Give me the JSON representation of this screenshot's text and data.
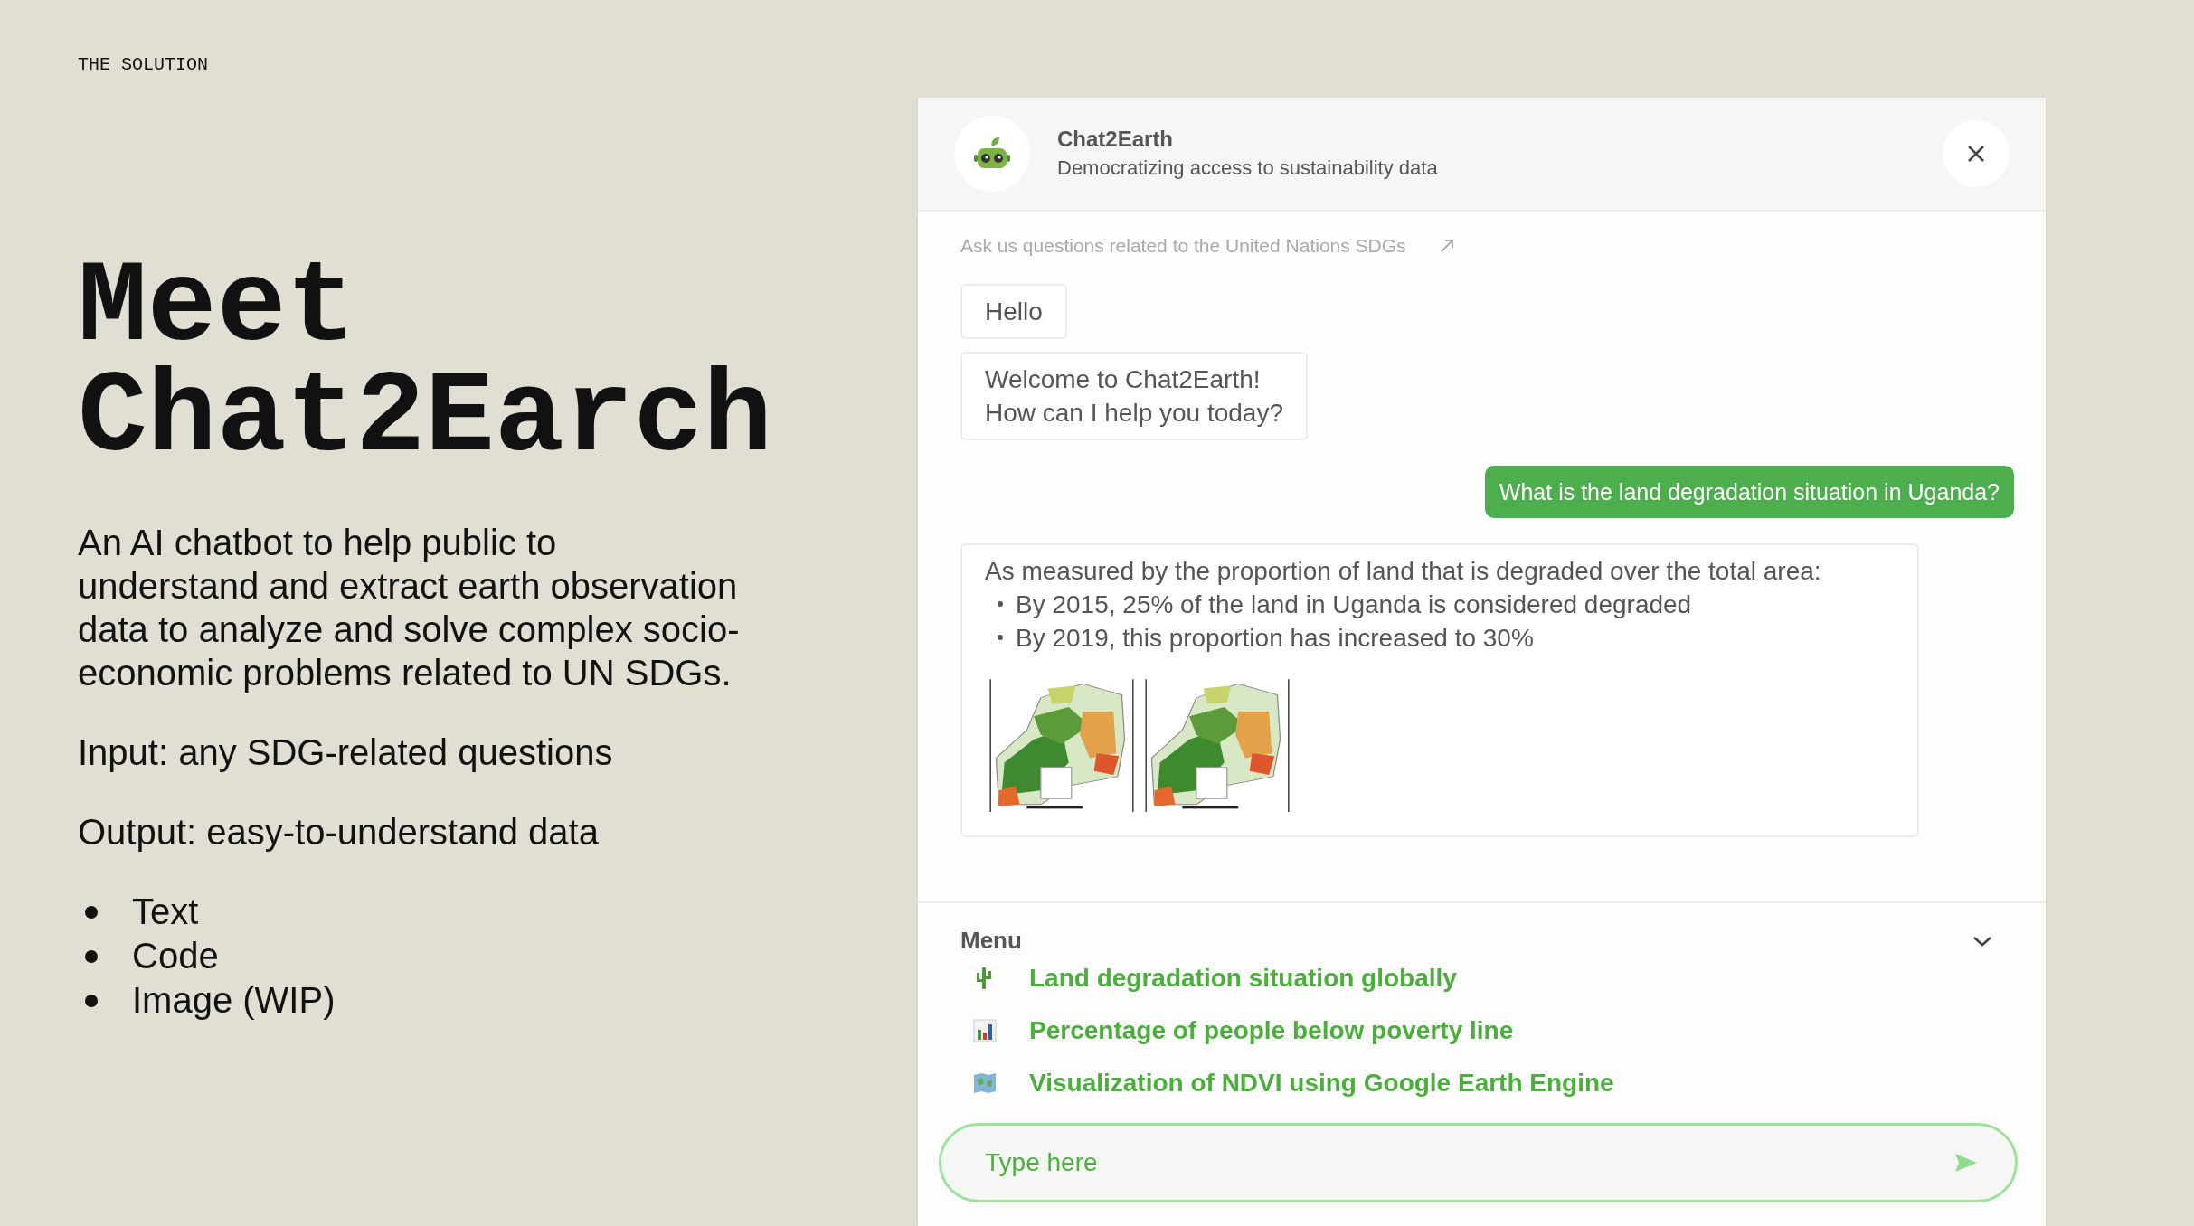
{
  "slide": {
    "eyebrow": "THE SOLUTION",
    "title_lines": [
      "Meet",
      "Chat2Earch"
    ],
    "description": "An AI chatbot to help public to understand and extract earth observation data to analyze and solve complex socio-economic problems related to UN SDGs.",
    "paragraphs": [
      "Input: any SDG-related questions",
      "Output: easy-to-understand data"
    ],
    "bullets": [
      "Text",
      "Code",
      "Image (WIP)"
    ]
  },
  "chat": {
    "title": "Chat2Earth",
    "subtitle": "Democratizing access to sustainability data",
    "hint": "Ask us questions related to the United Nations SDGs",
    "messages": [
      {
        "kind": "bot",
        "lines": [
          "Hello"
        ]
      },
      {
        "kind": "bot",
        "lines": [
          "Welcome to Chat2Earth!",
          "How can I help you today?"
        ]
      },
      {
        "kind": "user",
        "lines": [
          "What is the land degradation situation in Uganda?"
        ]
      },
      {
        "kind": "bot",
        "lines": [
          "As measured by the proportion of land that is degraded over the total area:"
        ],
        "bullets": [
          "By 2015, 25% of the land in Uganda is considered degraded",
          "By 2019, this proportion has increased to 30%"
        ],
        "pictures": [
          {
            "kind": "picture"
          },
          {
            "kind": "picture"
          }
        ]
      }
    ],
    "menu": {
      "title": "Menu",
      "expanded": true,
      "items": [
        "Land degradation situation globally",
        "Percentage of people below poverty line",
        "Visualization of NDVI using Google Earth Engine"
      ]
    },
    "input": {
      "placeholder": "Type here"
    }
  }
}
